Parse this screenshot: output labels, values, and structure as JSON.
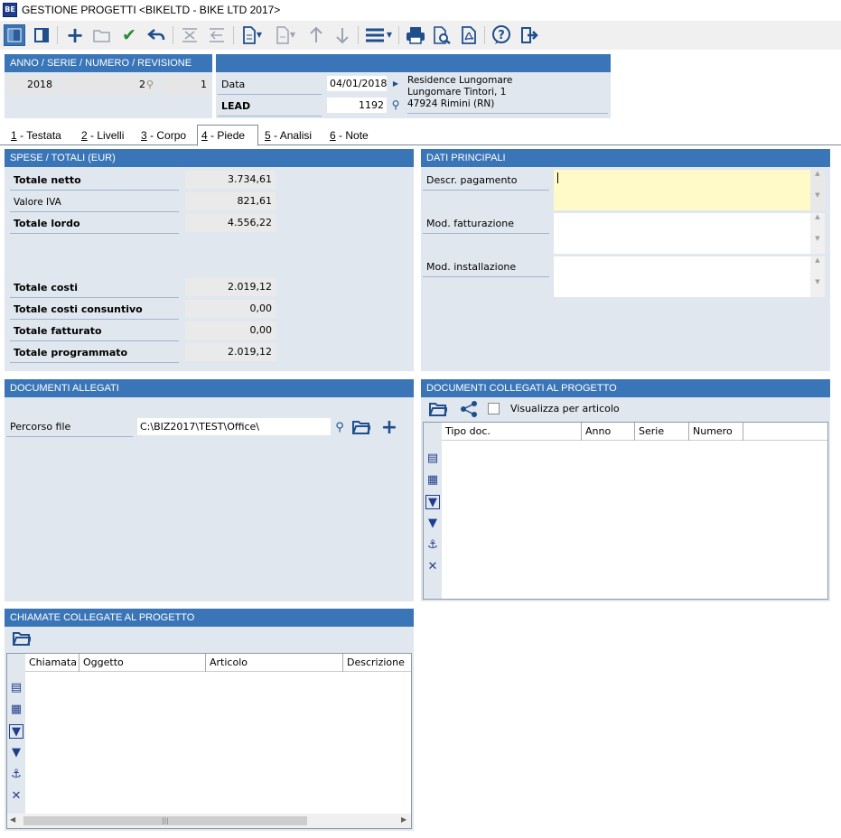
{
  "window": {
    "title": "GESTIONE PROGETTI <BIKELTD - BIKE LTD 2017>",
    "app_icon": "BE"
  },
  "header": {
    "anno_label": "ANNO / SERIE / NUMERO / REVISIONE",
    "anno": "2018",
    "serie": "",
    "numero": "2",
    "revisione": "1",
    "data_label": "Data",
    "data_value": "04/01/2018",
    "lead_label": "LEAD",
    "lead_value": "1192",
    "address_line1": "Residence Lungomare",
    "address_line2": "Lungomare Tintori, 1",
    "address_line3": "47924 Rimini (RN)"
  },
  "tabs": [
    {
      "key": "1",
      "label": " - Testata"
    },
    {
      "key": "2",
      "label": " - Livelli"
    },
    {
      "key": "3",
      "label": " - Corpo"
    },
    {
      "key": "4",
      "label": " - Piede"
    },
    {
      "key": "5",
      "label": " - Analisi"
    },
    {
      "key": "6",
      "label": " - Note"
    }
  ],
  "spese": {
    "title": "SPESE / TOTALI (EUR)",
    "totale_netto_label": "Totale netto",
    "totale_netto": "3.734,61",
    "valore_iva_label": "Valore IVA",
    "valore_iva": "821,61",
    "totale_lordo_label": "Totale lordo",
    "totale_lordo": "4.556,22",
    "totale_costi_label": "Totale costi",
    "totale_costi": "2.019,12",
    "totale_costi_consuntivo_label": "Totale costi consuntivo",
    "totale_costi_consuntivo": "0,00",
    "totale_fatturato_label": "Totale fatturato",
    "totale_fatturato": "0,00",
    "totale_programmato_label": "Totale programmato",
    "totale_programmato": "2.019,12"
  },
  "dati": {
    "title": "DATI PRINCIPALI",
    "descr_pagamento_label": "Descr. pagamento",
    "descr_pagamento": "",
    "mod_fatturazione_label": "Mod. fatturazione",
    "mod_fatturazione": "",
    "mod_installazione_label": "Mod. installazione",
    "mod_installazione": ""
  },
  "allegati": {
    "title": "DOCUMENTI ALLEGATI",
    "percorso_label": "Percorso file",
    "percorso_value": "C:\\BIZ2017\\TEST\\Office\\"
  },
  "collegati": {
    "title": "DOCUMENTI COLLEGATI AL PROGETTO",
    "visualizza_label": "Visualizza per articolo",
    "columns": [
      "Tipo doc.",
      "Anno",
      "Serie",
      "Numero"
    ]
  },
  "chiamate": {
    "title": "CHIAMATE COLLEGATE AL PROGETTO",
    "columns": [
      "Chiamata",
      "Oggetto",
      "Articolo",
      "Descrizione"
    ]
  },
  "colors": {
    "header_blue": "#3a76b7",
    "panel_bg": "#e1e7ef",
    "highlight_field": "#fffac8",
    "icon_blue": "#1f4e8c"
  }
}
